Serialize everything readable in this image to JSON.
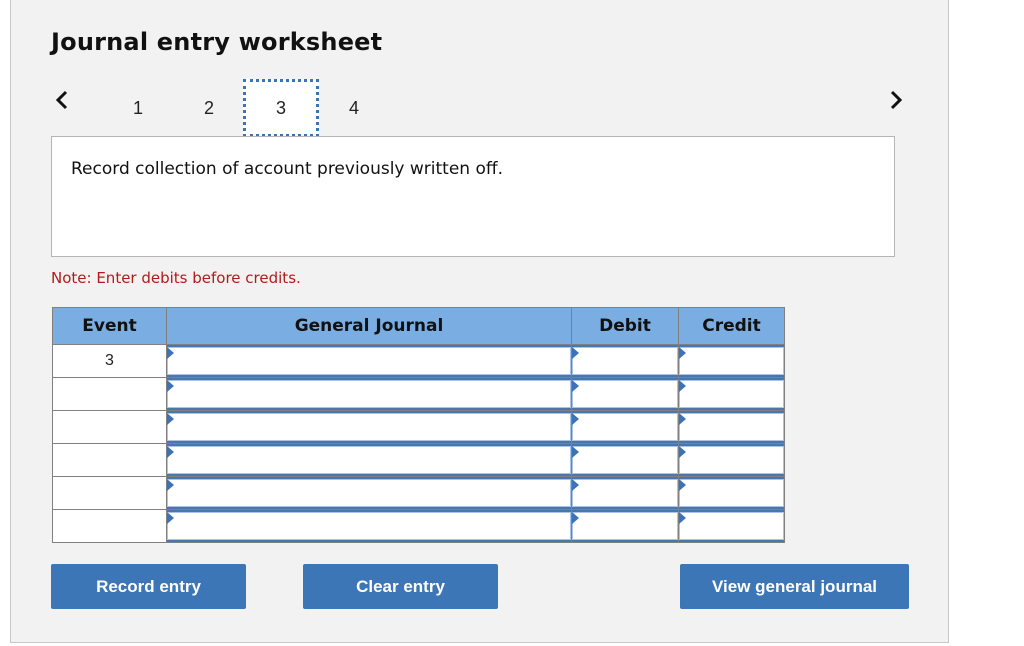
{
  "header": {
    "title": "Journal entry worksheet"
  },
  "nav": {
    "prev_icon": "chevron-left-icon",
    "next_icon": "chevron-right-icon",
    "steps": [
      {
        "label": "1",
        "active": false
      },
      {
        "label": "2",
        "active": false
      },
      {
        "label": "3",
        "active": true
      },
      {
        "label": "4",
        "active": false
      }
    ]
  },
  "prompt": {
    "text": "Record collection of account previously written off."
  },
  "note": {
    "text": "Note: Enter debits before credits."
  },
  "table": {
    "headers": {
      "event": "Event",
      "general_journal": "General Journal",
      "debit": "Debit",
      "credit": "Credit"
    },
    "rows": [
      {
        "event": "3",
        "account": "",
        "debit": "",
        "credit": ""
      },
      {
        "event": "",
        "account": "",
        "debit": "",
        "credit": ""
      },
      {
        "event": "",
        "account": "",
        "debit": "",
        "credit": ""
      },
      {
        "event": "",
        "account": "",
        "debit": "",
        "credit": ""
      },
      {
        "event": "",
        "account": "",
        "debit": "",
        "credit": ""
      },
      {
        "event": "",
        "account": "",
        "debit": "",
        "credit": ""
      }
    ]
  },
  "buttons": {
    "record": "Record entry",
    "clear": "Clear entry",
    "view": "View general journal"
  },
  "colors": {
    "accent": "#3d76b6",
    "header_bg": "#7aade2",
    "note": "#b31b1b",
    "panel_bg": "#f2f2f2"
  }
}
